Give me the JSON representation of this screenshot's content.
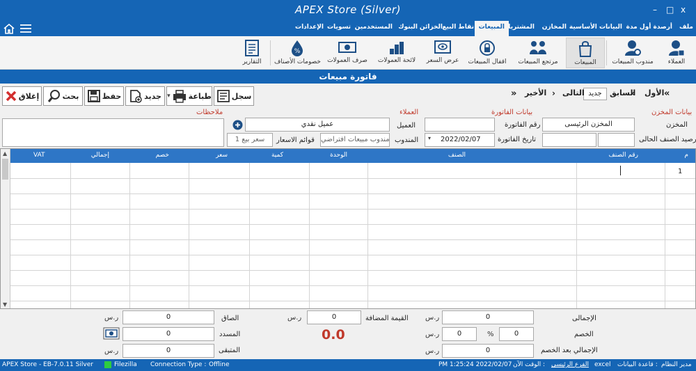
{
  "app": {
    "title": "APEX Store (Silver)",
    "close_label": "x",
    "maximize_label": "□",
    "minimize_label": "–"
  },
  "menu": [
    "ملف",
    "أرصدة أول مدة",
    "البيانات الأساسية",
    "المخازن",
    "المشتريات",
    "المبيعات",
    "نقاط البيع",
    "الخزائن",
    "البنوك",
    "المستخدمين",
    "تسويات",
    "الإعدادات"
  ],
  "menu_active": "المبيعات",
  "ribbon": {
    "customers": "العملاء",
    "sales_rep": "مندوب المبيعات",
    "sales": "المبيعات",
    "sales_returns": "مرتجع المبيعات",
    "close_sales": "اقفال المبيعات",
    "price_quote": "عرض السعر",
    "commissions_list": "لائحة العمولات",
    "pay_commissions": "صرف العمولات",
    "item_discounts": "خصومات الأصناف",
    "reports": "التقارير"
  },
  "form_title": "فاتورة مبيعات",
  "toolbar": {
    "close": "إغلاق",
    "search": "بحث",
    "save": "حفظ",
    "new": "جديد",
    "print": "طباعة",
    "log": "سجل"
  },
  "navigation": {
    "first": "الأول",
    "previous": "السابق",
    "status": "جديد",
    "next": "التالى",
    "last": "الأخير"
  },
  "store_group": {
    "title": "بيانات المخزن",
    "store_label": "المخزن",
    "store_value": "المخزن الرئيسى",
    "balance_label": "رصيد الصنف الحالى"
  },
  "invoice_group": {
    "title": "بيانات الفاتورة",
    "number_label": "رقم الفاتورة",
    "date_label": "تاريخ الفاتورة",
    "date_value": "2022/02/07"
  },
  "customer_group": {
    "title": "العملاء",
    "customer_label": "العميل",
    "customer_value": "عميل نقدي",
    "rep_label": "المندوب",
    "rep_value": "مندوب مبيعات افتراضي",
    "price_list_label": "قوائم الاسعار",
    "price_list_value": "سعر بيع 1"
  },
  "notes_label": "ملاحظات",
  "grid": {
    "headers": {
      "row_num": "م",
      "item_code": "رقم الصنف",
      "item": "الصنف",
      "unit": "الوحدة",
      "quantity": "كمية",
      "price": "سعر",
      "discount": "خصم",
      "total": "إجمالي",
      "vat": "VAT"
    },
    "rows": [
      {
        "num": "1"
      }
    ]
  },
  "summary": {
    "total_label": "الإجمالى",
    "total_value": "0",
    "discount_label": "الخصم",
    "discount_value": "0",
    "discount_percent": "0",
    "percent_sign": "%",
    "after_discount_label": "الإجمالي بعد الخصم",
    "after_discount_value": "0",
    "vat_label": "القيمة المضافة",
    "vat_value": "0",
    "big_value": "0.0",
    "net_label": "الصاق",
    "net_value": "0",
    "paid_label": "المسدد",
    "paid_value": "0",
    "remaining_label": "المتبقى",
    "remaining_value": "0",
    "currency": "ر.س"
  },
  "status": {
    "version": "APEX Store - EB-7.0.11  Silver",
    "filezilla": "Filezilla",
    "connection_label": "Connection Type :",
    "connection_value": "Offline",
    "time_label": "الوقت الآن :",
    "time_value": "PM 1:25:24 2022/02/07",
    "branch": "الفرع الرئيسى",
    "db_label": "قاعدة البيانات :",
    "db_value": "excel",
    "user": "مدير النظام"
  },
  "colors": {
    "primary": "#1565b5",
    "grid_header": "#2e76c6",
    "accent_red": "#c0392b"
  }
}
